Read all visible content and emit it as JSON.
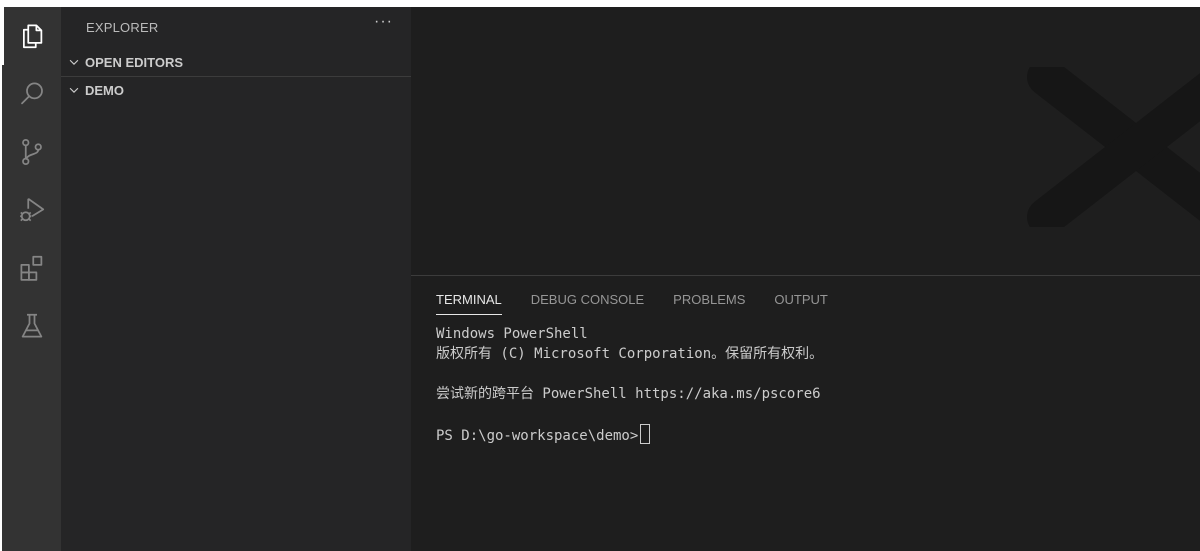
{
  "sidebar": {
    "title": "EXPLORER",
    "more": "···",
    "sections": [
      {
        "label": "OPEN EDITORS"
      },
      {
        "label": "DEMO"
      }
    ]
  },
  "activity_bar": {
    "items": [
      "explorer-icon",
      "search-icon",
      "source-control-icon",
      "run-debug-icon",
      "extensions-icon",
      "testing-icon"
    ]
  },
  "panel": {
    "tabs": [
      {
        "label": "TERMINAL",
        "active": true
      },
      {
        "label": "DEBUG CONSOLE",
        "active": false
      },
      {
        "label": "PROBLEMS",
        "active": false
      },
      {
        "label": "OUTPUT",
        "active": false
      }
    ],
    "terminal": {
      "lines": [
        "Windows PowerShell",
        "版权所有 (C) Microsoft Corporation。保留所有权利。",
        "",
        "尝试新的跨平台 PowerShell https://aka.ms/pscore6",
        "",
        "PS D:\\go-workspace\\demo>"
      ]
    }
  },
  "colors": {
    "activity_bar": "#333333",
    "sidebar": "#252526",
    "editor": "#1e1e1e",
    "text": "#cccccc"
  }
}
